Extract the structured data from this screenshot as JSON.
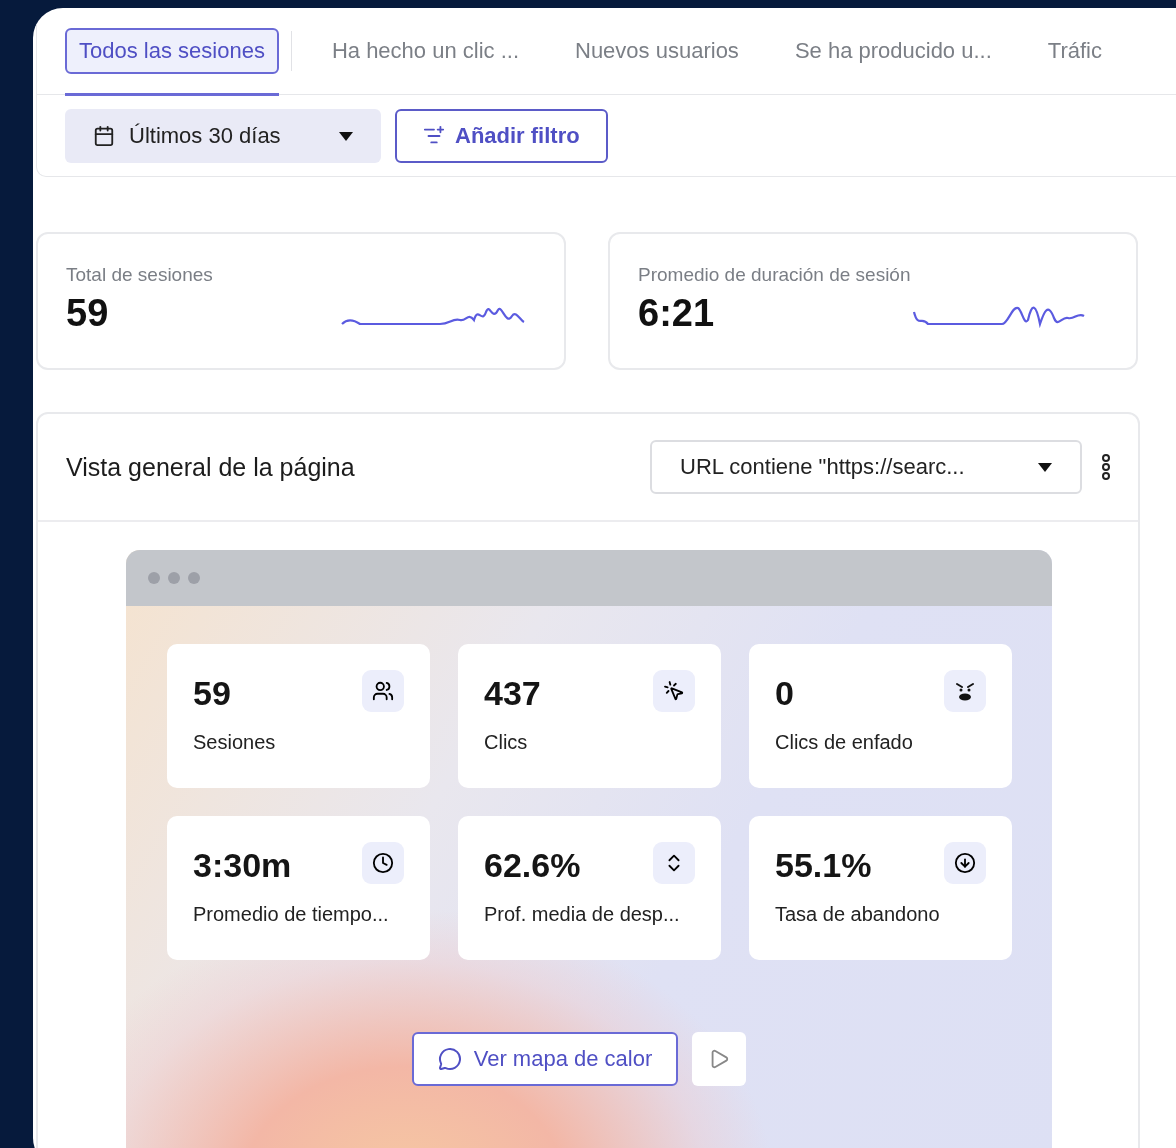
{
  "tabs": [
    {
      "label": "Todos las sesiones",
      "selected": true
    },
    {
      "label": "Ha hecho un clic ...",
      "selected": false
    },
    {
      "label": "Nuevos usuarios",
      "selected": false
    },
    {
      "label": "Se ha producido u...",
      "selected": false
    },
    {
      "label": "Tráfic",
      "selected": false
    }
  ],
  "date_filter": "Últimos 30 días",
  "add_filter": "Añadir filtro",
  "stats": [
    {
      "label": "Total de sesiones",
      "value": "59"
    },
    {
      "label": "Promedio de duración de sesión",
      "value": "6:21"
    }
  ],
  "overview": {
    "title": "Vista general de la página",
    "url_filter": "URL contiene \"https://searc...",
    "metrics": [
      {
        "value": "59",
        "label": "Sesiones",
        "kind": "users"
      },
      {
        "value": "437",
        "label": "Clics",
        "kind": "click"
      },
      {
        "value": "0",
        "label": "Clics de enfado",
        "kind": "angry"
      },
      {
        "value": "3:30m",
        "label": "Promedio de tiempo...",
        "kind": "clock"
      },
      {
        "value": "62.6%",
        "label": "Prof. media de desp...",
        "kind": "scroll"
      },
      {
        "value": "55.1%",
        "label": "Tasa de abandono",
        "kind": "exit"
      }
    ],
    "heatmap_button": "Ver mapa de calor"
  }
}
